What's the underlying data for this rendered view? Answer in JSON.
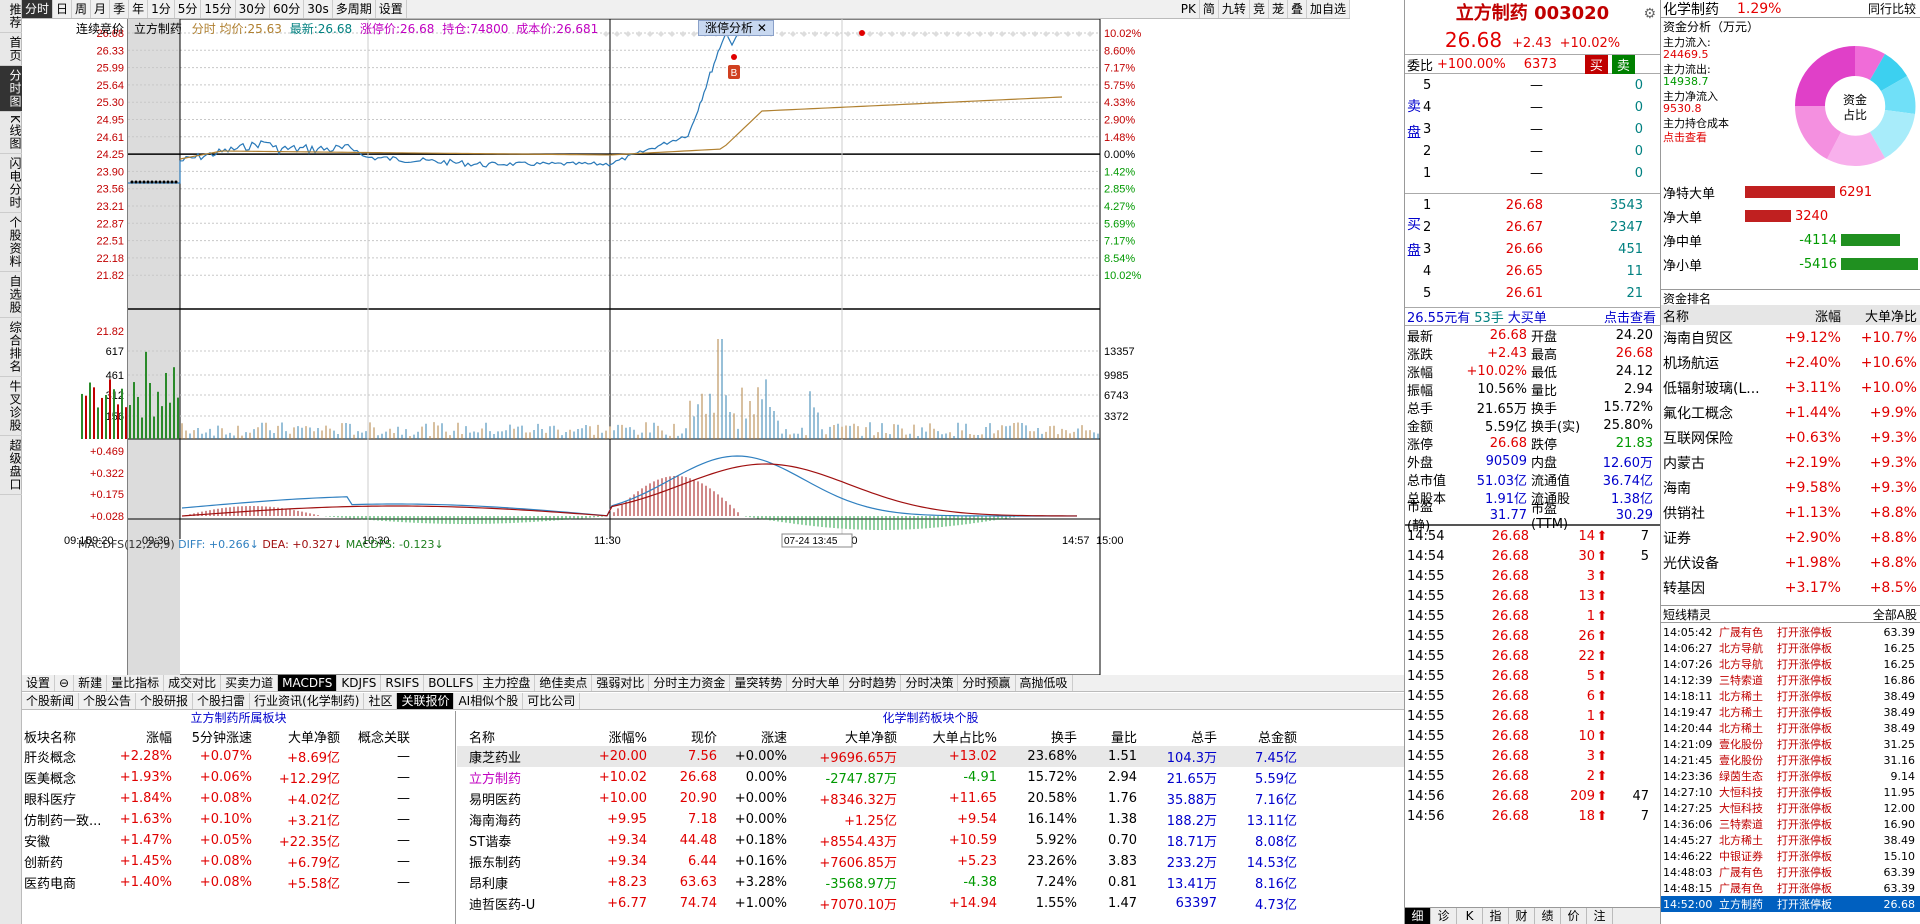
{
  "leftbar": [
    "推荐",
    "首页",
    "分时图",
    "K线图",
    "闪电分时",
    "个股资料",
    "自选股",
    "综合排名",
    "牛叉诊股",
    "超级盘口"
  ],
  "topbar": {
    "tabs": [
      "分时",
      "日",
      "周",
      "月",
      "季",
      "年",
      "1分",
      "5分",
      "15分",
      "30分",
      "60分",
      "30s",
      "多周期",
      "设置"
    ],
    "right": [
      "PK",
      "简",
      "九转",
      "竞",
      "茏",
      "叠",
      "加自选"
    ]
  },
  "chart": {
    "info": "连续竞价",
    "stock": "立方制药",
    "avg_label": "分时 均价:",
    "avg": "25.63",
    "latest_label": "最新:",
    "latest": "26.68",
    "limit_label": "涨停价:",
    "limit": "26.68",
    "hold_label": "持仓:",
    "hold": "74800",
    "cost_label": "成本价:",
    "cost": "26.681",
    "badge": "涨停分析",
    "price_ticks": [
      "26.68",
      "26.33",
      "25.99",
      "25.64",
      "25.30",
      "24.95",
      "24.61",
      "24.25",
      "23.90",
      "23.56",
      "23.21",
      "22.87",
      "22.51",
      "22.18",
      "21.82"
    ],
    "pct_ticks": [
      "10.02%",
      "8.60%",
      "7.17%",
      "5.75%",
      "4.33%",
      "2.90%",
      "1.48%",
      "0.00%",
      "1.42%",
      "2.85%",
      "4.27%",
      "5.69%",
      "7.17%",
      "8.54%",
      "10.02%"
    ],
    "vol_ticks_left": [
      "617",
      "461",
      "312",
      "156"
    ],
    "vol_ticks_right": [
      "13357",
      "9985",
      "6743",
      "3372"
    ],
    "macd_label": "MACDFS(12,26,9)",
    "diff": "DIFF: +0.266↓",
    "dea": "DEA: +0.327↓",
    "macdfs": "MACDFS: -0.123↓",
    "macd_ticks": [
      "+0.469",
      "+0.322",
      "+0.175",
      "+0.028"
    ],
    "time_ticks": [
      "09:15",
      "09:20",
      "09:30",
      "10:30",
      "11:30",
      "14:00",
      "14:57",
      "15:00"
    ],
    "crosshair": "07-24 13:45",
    "b_marker": "B"
  },
  "indicator_tabs": [
    "设置",
    "⊖",
    "新建",
    "量比指标",
    "成交对比",
    "买卖力道",
    "MACDFS",
    "KDJFS",
    "RSIFS",
    "BOLLFS",
    "主力控盘",
    "绝佳卖点",
    "强弱对比",
    "分时主力资金",
    "量突转势",
    "分时大单",
    "分时趋势",
    "分时决策",
    "分时预赢",
    "高抛低吸"
  ],
  "info_tabs": [
    "个股新闻",
    "个股公告",
    "个股研报",
    "个股扫雷",
    "行业资讯(化学制药)",
    "社区",
    "关联报价",
    "AI相似个股",
    "可比公司"
  ],
  "sector_table": {
    "title": "立方制药所属板块",
    "headers": [
      "板块名称",
      "涨幅",
      "5分钟涨速",
      "大单净额",
      "概念关联"
    ],
    "rows": [
      [
        "肝炎概念",
        "+2.28%",
        "+0.07%",
        "+8.69亿",
        "—"
      ],
      [
        "医美概念",
        "+1.93%",
        "+0.06%",
        "+12.29亿",
        "—"
      ],
      [
        "眼科医疗",
        "+1.84%",
        "+0.08%",
        "+4.02亿",
        "—"
      ],
      [
        "仿制药一致...",
        "+1.63%",
        "+0.10%",
        "+3.21亿",
        "—"
      ],
      [
        "安徽",
        "+1.47%",
        "+0.05%",
        "+22.35亿",
        "—"
      ],
      [
        "创新药",
        "+1.45%",
        "+0.08%",
        "+6.79亿",
        "—"
      ],
      [
        "医药电商",
        "+1.40%",
        "+0.08%",
        "+5.58亿",
        "—"
      ]
    ]
  },
  "stock_table": {
    "title": "化学制药板块个股",
    "headers": [
      "名称",
      "涨幅%",
      "现价",
      "涨速",
      "大单净额",
      "大单占比%",
      "换手",
      "量比",
      "总手",
      "总金额"
    ],
    "rows": [
      [
        "康芝药业",
        "+20.00",
        "7.56",
        "+0.00%",
        "+9696.65万",
        "+13.02",
        "23.68%",
        "1.51",
        "104.3万",
        "7.45亿"
      ],
      [
        "立方制药",
        "+10.02",
        "26.68",
        "0.00%",
        "-2747.87万",
        "-4.91",
        "15.72%",
        "2.94",
        "21.65万",
        "5.59亿"
      ],
      [
        "易明医药",
        "+10.00",
        "20.90",
        "+0.00%",
        "+8346.32万",
        "+11.65",
        "20.58%",
        "1.76",
        "35.88万",
        "7.16亿"
      ],
      [
        "海南海药",
        "+9.95",
        "7.18",
        "+0.00%",
        "+1.25亿",
        "+9.54",
        "16.14%",
        "1.38",
        "188.2万",
        "13.11亿"
      ],
      [
        "ST谐泰",
        "+9.34",
        "44.48",
        "+0.18%",
        "+8554.43万",
        "+10.59",
        "5.92%",
        "0.70",
        "18.71万",
        "8.08亿"
      ],
      [
        "振东制药",
        "+9.34",
        "6.44",
        "+0.16%",
        "+7606.85万",
        "+5.23",
        "23.26%",
        "3.83",
        "233.2万",
        "14.53亿"
      ],
      [
        "昂利康",
        "+8.23",
        "63.63",
        "+3.28%",
        "-3568.97万",
        "-4.38",
        "7.24%",
        "0.81",
        "13.41万",
        "8.16亿"
      ],
      [
        "迪哲医药-U",
        "+6.77",
        "74.74",
        "+1.00%",
        "+7070.10万",
        "+14.94",
        "1.55%",
        "1.47",
        "63397",
        "4.73亿"
      ]
    ]
  },
  "quote": {
    "name": "立方制药",
    "code": "003020",
    "price": "26.68",
    "chg": "+2.43",
    "pct": "+10.02%",
    "weibi_label": "委比",
    "weibi": "+100.00%",
    "weicha": "6373",
    "buy": "买",
    "sell": "卖",
    "sell_rows": [
      [
        "5",
        "—",
        "0"
      ],
      [
        "4",
        "—",
        "0"
      ],
      [
        "3",
        "—",
        "0"
      ],
      [
        "2",
        "—",
        "0"
      ],
      [
        "1",
        "—",
        "0"
      ]
    ],
    "buy_rows": [
      [
        "1",
        "26.68",
        "3543"
      ],
      [
        "2",
        "26.67",
        "2347"
      ],
      [
        "3",
        "26.66",
        "451"
      ],
      [
        "4",
        "26.65",
        "11"
      ],
      [
        "5",
        "26.61",
        "21"
      ]
    ],
    "sell_label": "卖盘",
    "buy_label": "买盘",
    "bigorder": "26.55元有",
    "bigorder_n": "53手",
    "bigorder_s": "大买单",
    "click": "点击查看",
    "stats": [
      [
        "最新",
        "26.68",
        "开盘",
        "24.20"
      ],
      [
        "涨跌",
        "+2.43",
        "最高",
        "26.68"
      ],
      [
        "涨幅",
        "+10.02%",
        "最低",
        "24.12"
      ],
      [
        "振幅",
        "10.56%",
        "量比",
        "2.94"
      ],
      [
        "总手",
        "21.65万",
        "换手",
        "15.72%"
      ],
      [
        "金额",
        "5.59亿",
        "换手(实)",
        "25.80%"
      ],
      [
        "涨停",
        "26.68",
        "跌停",
        "21.83"
      ],
      [
        "外盘",
        "90509",
        "内盘",
        "12.60万"
      ],
      [
        "总市值",
        "51.03亿",
        "流通值",
        "36.74亿"
      ],
      [
        "总股本",
        "1.91亿",
        "流通股",
        "1.38亿"
      ],
      [
        "市盈(静)",
        "31.77",
        "市盈(TTM)",
        "30.29"
      ]
    ],
    "ticks": [
      [
        "14:54",
        "26.68",
        "14",
        "7"
      ],
      [
        "14:54",
        "26.68",
        "30",
        "5"
      ],
      [
        "14:55",
        "26.68",
        "3",
        ""
      ],
      [
        "14:55",
        "26.68",
        "13",
        ""
      ],
      [
        "14:55",
        "26.68",
        "1",
        ""
      ],
      [
        "14:55",
        "26.68",
        "26",
        ""
      ],
      [
        "14:55",
        "26.68",
        "22",
        ""
      ],
      [
        "14:55",
        "26.68",
        "5",
        ""
      ],
      [
        "14:55",
        "26.68",
        "6",
        ""
      ],
      [
        "14:55",
        "26.68",
        "1",
        ""
      ],
      [
        "14:55",
        "26.68",
        "10",
        ""
      ],
      [
        "14:55",
        "26.68",
        "3",
        ""
      ],
      [
        "14:55",
        "26.68",
        "2",
        ""
      ],
      [
        "14:56",
        "26.68",
        "209",
        "47"
      ],
      [
        "14:56",
        "26.68",
        "18",
        "7"
      ]
    ],
    "bottom_tabs": [
      "细",
      "诊",
      "K",
      "指",
      "财",
      "绩",
      "价",
      "注"
    ]
  },
  "far": {
    "sector": "化学制药",
    "sector_pct": "1.29%",
    "peer": "同行比较",
    "fund_title": "资金分析（万元）",
    "fund": [
      [
        "主力流入:",
        "24469.5"
      ],
      [
        "主力流出:",
        "14938.7"
      ],
      [
        "主力净流入",
        "9530.8"
      ],
      [
        "主力持仓成本",
        ""
      ],
      [
        "点击查看",
        ""
      ]
    ],
    "donut_label": "资金占比",
    "net": [
      [
        "净特大单",
        "6291"
      ],
      [
        "净大单",
        "3240"
      ],
      [
        "净中单",
        "-4114"
      ],
      [
        "净小单",
        "-5416"
      ]
    ],
    "rank_title": "资金排名",
    "rank_headers": [
      "名称",
      "涨幅",
      "大单净比"
    ],
    "rank": [
      [
        "海南自贸区",
        "+9.12%",
        "+10.7%"
      ],
      [
        "机场航运",
        "+2.40%",
        "+10.6%"
      ],
      [
        "低辐射玻璃(L...",
        "+3.11%",
        "+10.0%"
      ],
      [
        "氟化工概念",
        "+1.44%",
        "+9.9%"
      ],
      [
        "互联网保险",
        "+0.63%",
        "+9.3%"
      ],
      [
        "内蒙古",
        "+2.19%",
        "+9.3%"
      ],
      [
        "海南",
        "+9.58%",
        "+9.3%"
      ],
      [
        "供销社",
        "+1.13%",
        "+8.8%"
      ],
      [
        "证券",
        "+2.90%",
        "+8.8%"
      ],
      [
        "光伏设备",
        "+1.98%",
        "+8.8%"
      ],
      [
        "转基因",
        "+3.17%",
        "+8.5%"
      ]
    ],
    "short_title": "短线精灵",
    "short_filter": "全部A股",
    "short": [
      [
        "14:05:42",
        "广晟有色",
        "打开涨停板",
        "63.39"
      ],
      [
        "14:06:27",
        "北方导航",
        "打开涨停板",
        "16.25"
      ],
      [
        "14:07:26",
        "北方导航",
        "打开涨停板",
        "16.25"
      ],
      [
        "14:12:39",
        "三特索道",
        "打开涨停板",
        "16.86"
      ],
      [
        "14:18:11",
        "北方稀土",
        "打开涨停板",
        "38.49"
      ],
      [
        "14:19:47",
        "北方稀土",
        "打开涨停板",
        "38.49"
      ],
      [
        "14:20:44",
        "北方稀土",
        "打开涨停板",
        "38.49"
      ],
      [
        "14:21:09",
        "壹化股份",
        "打开涨停板",
        "31.25"
      ],
      [
        "14:21:45",
        "壹化股份",
        "打开涨停板",
        "31.16"
      ],
      [
        "14:23:36",
        "绿茵生态",
        "打开涨停板",
        "9.14"
      ],
      [
        "14:27:10",
        "大恒科技",
        "打开涨停板",
        "11.95"
      ],
      [
        "14:27:25",
        "大恒科技",
        "打开涨停板",
        "12.00"
      ],
      [
        "14:36:06",
        "三特索道",
        "打开涨停板",
        "16.90"
      ],
      [
        "14:45:27",
        "北方稀土",
        "打开涨停板",
        "38.49"
      ],
      [
        "14:46:22",
        "中银证券",
        "打开涨停板",
        "15.10"
      ],
      [
        "14:48:03",
        "广晟有色",
        "打开涨停板",
        "63.39"
      ],
      [
        "14:48:15",
        "广晟有色",
        "打开涨停板",
        "63.39"
      ],
      [
        "14:52:00",
        "立方制药",
        "打开涨停板",
        "26.68"
      ]
    ]
  }
}
